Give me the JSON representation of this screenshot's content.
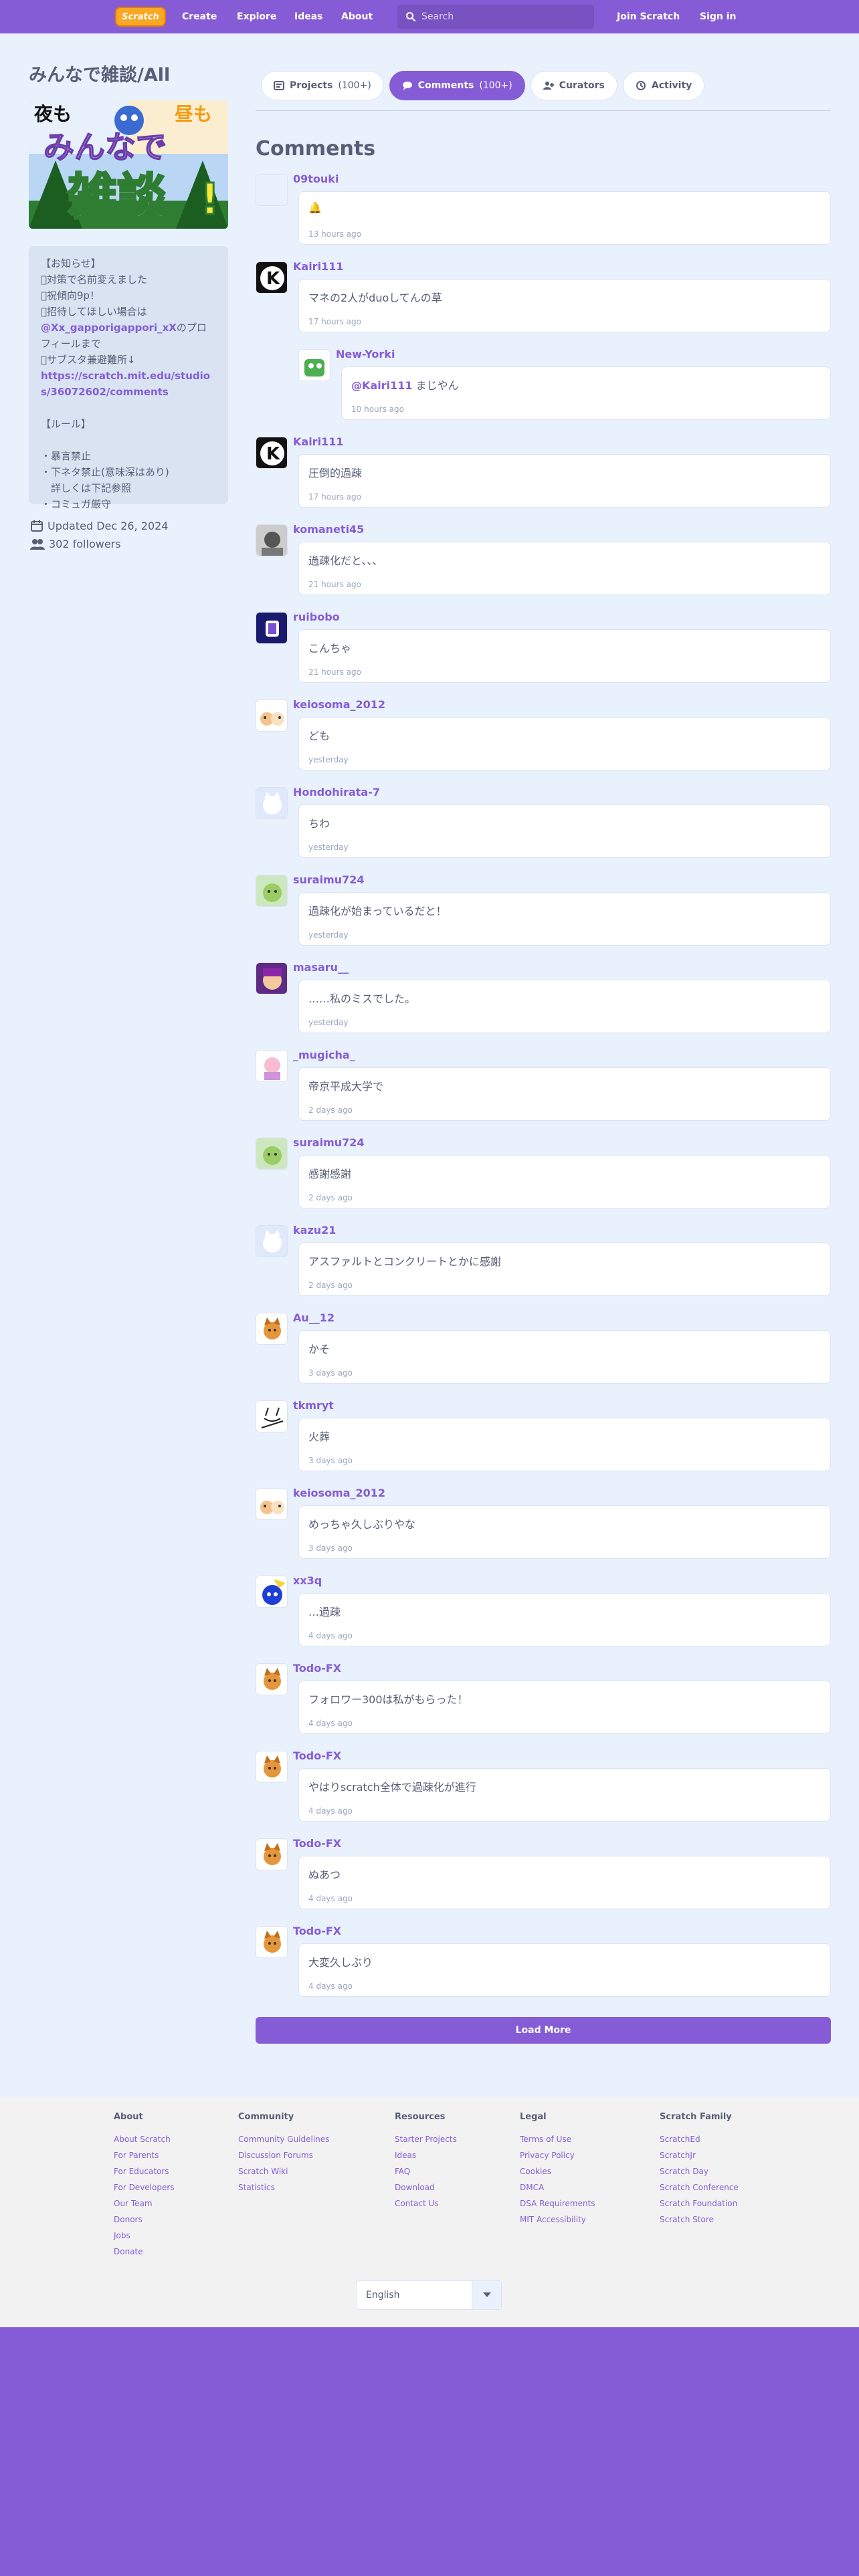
{
  "nav": {
    "logo_text": "Scratch",
    "links": [
      "Create",
      "Explore",
      "Ideas",
      "About"
    ],
    "search_placeholder": "Search",
    "join": "Join Scratch",
    "signin": "Sign in",
    "accent_color": "#855cd6"
  },
  "studio": {
    "title": "みんなで雑談/All",
    "thumbnail_text": {
      "left": "夜も",
      "right": "昼も",
      "mid": "みんなで",
      "big": "雑談",
      "mark": "!"
    },
    "description_lines": [
      "【お知らせ】",
      "対策で名前変えました",
      "祝傾向9p！",
      "招待してほしい場合は",
      "@Xx_gapporigappori_xX",
      "のプロフィールまで",
      "サブスタ兼避難所↓",
      "https://scratch.mit.edu/studios/36072602/comments",
      "【ルール】",
      "・暴言禁止",
      "・下ネタ禁止(意味深はあり)",
      "　詳しくは下記参照",
      "・コミュガ厳守"
    ],
    "updated": "Updated Dec 26, 2024",
    "followers": "302 followers"
  },
  "tabs": [
    {
      "label": "Projects",
      "count": "(100+)",
      "icon": "projects-icon"
    },
    {
      "label": "Comments",
      "count": "(100+)",
      "icon": "comments-icon"
    },
    {
      "label": "Curators",
      "count": "",
      "icon": "curators-icon"
    },
    {
      "label": "Activity",
      "count": "",
      "icon": "activity-icon"
    }
  ],
  "comments_heading": "Comments",
  "comments": [
    {
      "user": "09touki",
      "text": "🔔",
      "time": "13 hours ago",
      "avatar": "blank"
    },
    {
      "user": "Kairi111",
      "text": "マネの2人がduoしてんの草",
      "time": "17 hours ago",
      "avatar": "k-logo"
    },
    {
      "user": "New-Yorki",
      "mention": "@Kairi111",
      "text": " まじやん",
      "time": "10 hours ago",
      "avatar": "green",
      "reply": true
    },
    {
      "user": "Kairi111",
      "text": "圧倒的過疎",
      "time": "17 hours ago",
      "avatar": "k-logo"
    },
    {
      "user": "komaneti45",
      "text": "過疎化だと、、、",
      "time": "21 hours ago",
      "avatar": "gray"
    },
    {
      "user": "ruibobo",
      "text": "こんちゃ",
      "time": "21 hours ago",
      "avatar": "navy"
    },
    {
      "user": "keiosoma_2012",
      "text": "ども",
      "time": "yesterday",
      "avatar": "cats"
    },
    {
      "user": "Hondohirata-7",
      "text": "ちわ",
      "time": "yesterday",
      "avatar": "blue-cat"
    },
    {
      "user": "suraimu724",
      "text": "過疎化が始まっているだと！",
      "time": "yesterday",
      "avatar": "green-cat"
    },
    {
      "user": "masaru__",
      "text": "……私のミスでした。",
      "time": "yesterday",
      "avatar": "purple"
    },
    {
      "user": "_mugicha_",
      "text": "帝京平成大学で",
      "time": "2 days ago",
      "avatar": "pink"
    },
    {
      "user": "suraimu724",
      "text": "感謝感謝",
      "time": "2 days ago",
      "avatar": "green-cat"
    },
    {
      "user": "kazu21",
      "text": "アスファルトとコンクリートとかに感謝",
      "time": "2 days ago",
      "avatar": "blue-cat"
    },
    {
      "user": "Au__12",
      "text": "かそ",
      "time": "3 days ago",
      "avatar": "orange"
    },
    {
      "user": "tkmryt",
      "text": "火葬",
      "time": "3 days ago",
      "avatar": "line"
    },
    {
      "user": "keiosoma_2012",
      "text": "めっちゃ久しぶりやな",
      "time": "3 days ago",
      "avatar": "cats"
    },
    {
      "user": "xx3q",
      "text": "…過疎",
      "time": "4 days ago",
      "avatar": "blue-round"
    },
    {
      "user": "Todo-FX",
      "text": "フォロワー300は私がもらった！",
      "time": "4 days ago",
      "avatar": "orange"
    },
    {
      "user": "Todo-FX",
      "text": "やはりscratch全体で過疎化が進行",
      "time": "4 days ago",
      "avatar": "orange"
    },
    {
      "user": "Todo-FX",
      "text": "ぬあつ",
      "time": "4 days ago",
      "avatar": "orange"
    },
    {
      "user": "Todo-FX",
      "text": "大変久しぶり",
      "time": "4 days ago",
      "avatar": "orange"
    }
  ],
  "load_more": "Load More",
  "footer": {
    "columns": [
      {
        "title": "About",
        "links": [
          "About Scratch",
          "For Parents",
          "For Educators",
          "For Developers",
          "Our Team",
          "Donors",
          "Jobs",
          "Donate"
        ]
      },
      {
        "title": "Community",
        "links": [
          "Community Guidelines",
          "Discussion Forums",
          "Scratch Wiki",
          "Statistics"
        ]
      },
      {
        "title": "Resources",
        "links": [
          "Starter Projects",
          "Ideas",
          "FAQ",
          "Download",
          "Contact Us"
        ]
      },
      {
        "title": "Legal",
        "links": [
          "Terms of Use",
          "Privacy Policy",
          "Cookies",
          "DMCA",
          "DSA Requirements",
          "MIT Accessibility"
        ]
      },
      {
        "title": "Scratch Family",
        "links": [
          "ScratchEd",
          "ScratchJr",
          "Scratch Day",
          "Scratch Conference",
          "Scratch Foundation",
          "Scratch Store"
        ]
      }
    ],
    "language": "English"
  }
}
